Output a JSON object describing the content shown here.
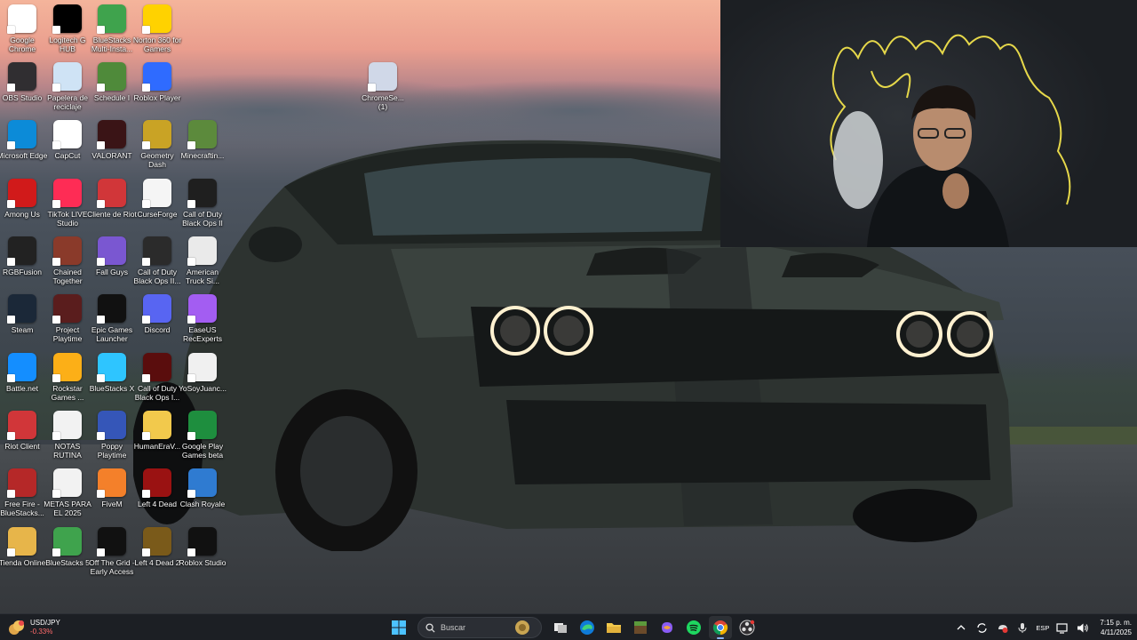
{
  "desktop": {
    "icons": [
      {
        "label": "Google Chrome",
        "icon": "chrome-icon",
        "color": "#ffffff"
      },
      {
        "label": "Logitech G HUB",
        "icon": "logitech-g-icon",
        "color": "#000000"
      },
      {
        "label": "BlueStacks Multi-Insta...",
        "icon": "bluestacks-multi-icon",
        "color": "#3fa34d"
      },
      {
        "label": "Norton 360 for Gamers",
        "icon": "norton-icon",
        "color": "#ffd200"
      },
      {
        "label": "OBS Studio",
        "icon": "obs-icon",
        "color": "#302e31"
      },
      {
        "label": "Papelera de reciclaje",
        "icon": "recycle-bin-icon",
        "color": "#cfe3f5"
      },
      {
        "label": "Schedule I",
        "icon": "schedule-i-icon",
        "color": "#4f8a3a"
      },
      {
        "label": "Roblox Player",
        "icon": "roblox-player-icon",
        "color": "#2f6bff"
      },
      {
        "label": "Microsoft Edge",
        "icon": "edge-icon",
        "color": "#0c8bd8"
      },
      {
        "label": "CapCut",
        "icon": "capcut-icon",
        "color": "#ffffff"
      },
      {
        "label": "VALORANT",
        "icon": "valorant-icon",
        "color": "#3a1416"
      },
      {
        "label": "Geometry Dash",
        "icon": "geometry-dash-icon",
        "color": "#c9a325"
      },
      {
        "label": "Minecraftin...",
        "icon": "minecraft-icon",
        "color": "#5c8a3c"
      },
      {
        "label": "Among Us",
        "icon": "among-us-icon",
        "color": "#d11a1a"
      },
      {
        "label": "TikTok LIVE Studio",
        "icon": "tiktok-live-icon",
        "color": "#fe2c55"
      },
      {
        "label": "Cliente de Riot",
        "icon": "riot-client-icon",
        "color": "#d13639"
      },
      {
        "label": "CurseForge",
        "icon": "curseforge-icon",
        "color": "#f5f5f5"
      },
      {
        "label": "Call of Duty Black Ops II",
        "icon": "cod-bo2-icon",
        "color": "#1f1f1f"
      },
      {
        "label": "RGBFusion",
        "icon": "rgbfusion-icon",
        "color": "#222222"
      },
      {
        "label": "Chained Together",
        "icon": "chained-together-icon",
        "color": "#8a3a2a"
      },
      {
        "label": "Fall Guys",
        "icon": "fall-guys-icon",
        "color": "#7a57d1"
      },
      {
        "label": "Call of Duty Black Ops II...",
        "icon": "cod-bo2-zombies-icon",
        "color": "#2b2b2b"
      },
      {
        "label": "American Truck Si...",
        "icon": "ats-icon",
        "color": "#eaeaea"
      },
      {
        "label": "Steam",
        "icon": "steam-icon",
        "color": "#1b2838"
      },
      {
        "label": "Project Playtime",
        "icon": "project-playtime-icon",
        "color": "#5a1d1d"
      },
      {
        "label": "Epic Games Launcher",
        "icon": "epic-games-icon",
        "color": "#111111"
      },
      {
        "label": "Discord",
        "icon": "discord-icon",
        "color": "#5865f2"
      },
      {
        "label": "EaseUS RecExperts",
        "icon": "easeus-icon",
        "color": "#a35df2"
      },
      {
        "label": "Battle.net",
        "icon": "battlenet-icon",
        "color": "#148eff"
      },
      {
        "label": "Rockstar Games ...",
        "icon": "rockstar-icon",
        "color": "#fcaf17"
      },
      {
        "label": "BlueStacks X",
        "icon": "bluestacks-x-icon",
        "color": "#2ec5ff"
      },
      {
        "label": "Call of Duty Black Ops I...",
        "icon": "cod-bo-icon",
        "color": "#5a0d0d"
      },
      {
        "label": "YoSoyJuanc...",
        "icon": "video-file-icon",
        "color": "#f0f0f0"
      },
      {
        "label": "Riot Client",
        "icon": "riot-icon",
        "color": "#d13639"
      },
      {
        "label": "NOTAS RUTINA",
        "icon": "text-file-icon",
        "color": "#f2f2f2"
      },
      {
        "label": "Poppy Playtime",
        "icon": "poppy-playtime-icon",
        "color": "#3556b8"
      },
      {
        "label": "HumanEraV...",
        "icon": "folder-icon",
        "color": "#f2c94c"
      },
      {
        "label": "Google Play Games beta",
        "icon": "google-play-games-icon",
        "color": "#1e8e3e"
      },
      {
        "label": "Free Fire - BlueStacks...",
        "icon": "free-fire-icon",
        "color": "#b52828"
      },
      {
        "label": "METAS PARA EL 2025",
        "icon": "text-file-icon",
        "color": "#f2f2f2"
      },
      {
        "label": "FiveM",
        "icon": "fivem-icon",
        "color": "#f4802a"
      },
      {
        "label": "Left 4 Dead",
        "icon": "left4dead-icon",
        "color": "#9a1212"
      },
      {
        "label": "Clash Royale",
        "icon": "clash-royale-icon",
        "color": "#2f7bd1"
      },
      {
        "label": "Tienda Online",
        "icon": "shop-icon",
        "color": "#e7b54a"
      },
      {
        "label": "BlueStacks 5",
        "icon": "bluestacks5-icon",
        "color": "#3fa34d"
      },
      {
        "label": "Off The Grid - Early Access",
        "icon": "off-the-grid-icon",
        "color": "#111111"
      },
      {
        "label": "Left 4 Dead 2",
        "icon": "left4dead2-icon",
        "color": "#7a5a1a"
      },
      {
        "label": "Roblox Studio",
        "icon": "roblox-studio-icon",
        "color": "#111111"
      },
      {
        "label": "ChromeSe... (1)",
        "icon": "installer-icon",
        "color": "#d0d8e8"
      }
    ]
  },
  "taskbar": {
    "widget": {
      "name": "USD/JPY",
      "change": "-0.33%"
    },
    "search_placeholder": "Buscar",
    "pinned": [
      {
        "name": "start",
        "icon": "windows-start-icon"
      },
      {
        "name": "task-view",
        "icon": "task-view-icon"
      },
      {
        "name": "edge",
        "icon": "edge-icon"
      },
      {
        "name": "file-explorer",
        "icon": "folder-icon"
      },
      {
        "name": "minecraft",
        "icon": "minecraft-icon"
      },
      {
        "name": "copilot",
        "icon": "copilot-icon"
      },
      {
        "name": "spotify",
        "icon": "spotify-icon"
      },
      {
        "name": "chrome",
        "icon": "chrome-icon"
      },
      {
        "name": "obs",
        "icon": "obs-icon"
      }
    ],
    "tray": {
      "language": "ESP",
      "time": "7:15 p. m.",
      "date": "4/11/2025"
    }
  }
}
